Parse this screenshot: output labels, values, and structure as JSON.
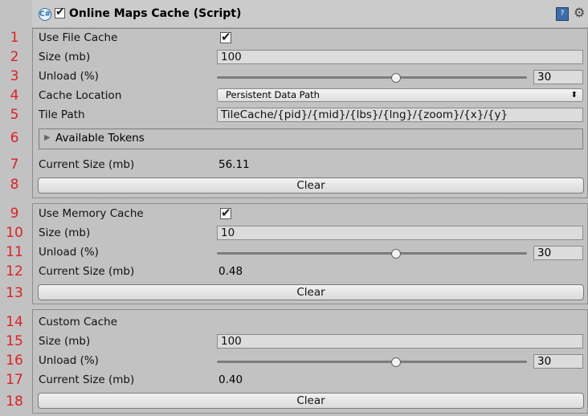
{
  "header": {
    "title": "Online Maps Cache (Script)",
    "enabled": true,
    "script_icon": "C#"
  },
  "row_numbers": [
    "1",
    "2",
    "3",
    "4",
    "5",
    "6",
    "7",
    "8",
    "9",
    "10",
    "11",
    "12",
    "13",
    "14",
    "15",
    "16",
    "17",
    "18"
  ],
  "file_cache": {
    "use_label": "Use File Cache",
    "use_checked": true,
    "size_label": "Size (mb)",
    "size_value": "100",
    "unload_label": "Unload (%)",
    "unload_value": "30",
    "unload_level": 0.58,
    "location_label": "Cache Location",
    "location_value": "Persistent Data Path",
    "tile_path_label": "Tile Path",
    "tile_path_value": "TileCache/{pid}/{mid}/{lbs}/{lng}/{zoom}/{x}/{y}",
    "tokens_label": "Available Tokens",
    "current_size_label": "Current Size (mb)",
    "current_size_value": "56.11",
    "clear_label": "Clear"
  },
  "memory_cache": {
    "use_label": "Use Memory Cache",
    "use_checked": true,
    "size_label": "Size (mb)",
    "size_value": "10",
    "unload_label": "Unload (%)",
    "unload_value": "30",
    "unload_level": 0.58,
    "current_size_label": "Current Size (mb)",
    "current_size_value": "0.48",
    "clear_label": "Clear"
  },
  "custom_cache": {
    "title_label": "Custom Cache",
    "size_label": "Size (mb)",
    "size_value": "100",
    "unload_label": "Unload (%)",
    "unload_value": "30",
    "unload_level": 0.58,
    "current_size_label": "Current Size (mb)",
    "current_size_value": "0.40",
    "clear_label": "Clear"
  },
  "colors": {
    "background": "#c2c2c2",
    "annotation_numbers": "#e02020"
  }
}
